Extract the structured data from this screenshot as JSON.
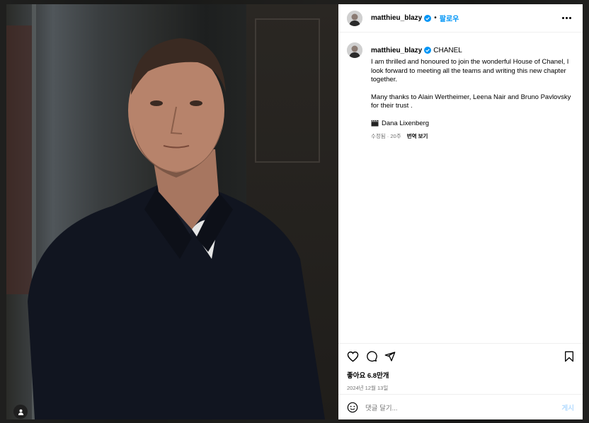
{
  "colors": {
    "accent": "#0095f6",
    "verified": "#0095f6",
    "muted": "#737373"
  },
  "post": {
    "username": "matthieu_blazy",
    "separator": "•",
    "follow_label": "팔로우",
    "more_icon": "more-horizontal-icon"
  },
  "caption": {
    "username": "matthieu_blazy",
    "tag": "CHANEL",
    "paragraphs": [
      "I am thrilled and honoured to join the wonderful House of Chanel, I look forward to meeting all the teams and writing this new chapter together.",
      "Many thanks to Alain Wertheimer, Leena Nair and Bruno Pavlovsky for their trust ."
    ],
    "credit_icon": "clapperboard-icon",
    "credit": "Dana Lixenberg",
    "meta": "수정됨 · 20주",
    "translate": "번역 보기"
  },
  "actions": {
    "likes": "좋아요 6.8만개",
    "date": "2024년 12월 13일"
  },
  "comment": {
    "emoji_icon": "smile-icon",
    "placeholder": "댓글 달기...",
    "post_label": "게시"
  },
  "media": {
    "tagged_user_icon": "user-icon"
  }
}
